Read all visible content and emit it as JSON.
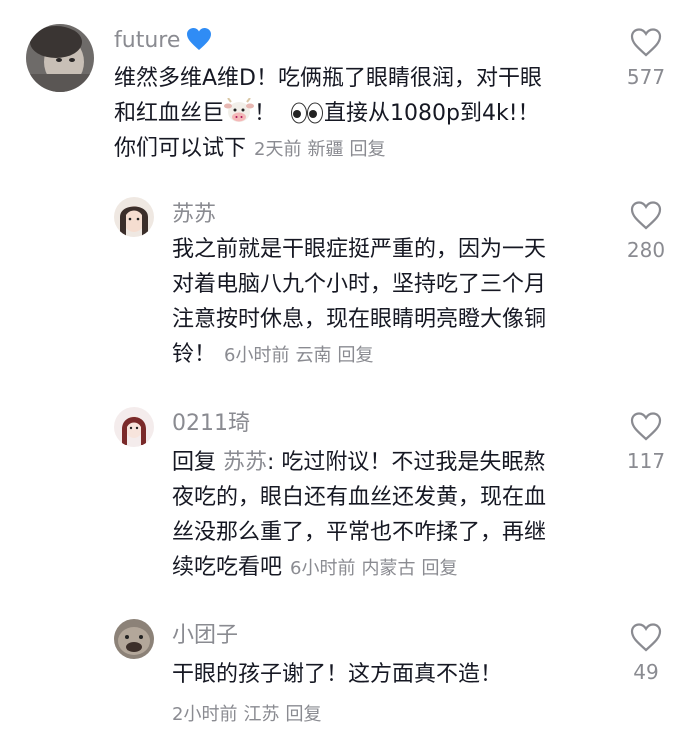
{
  "comments": [
    {
      "username": "future",
      "lines": [
        "维然多维A维D！吃俩瓶了眼睛很润，对干眼",
        "和红血丝巨",
        "！",
        "直接从1080p到4k!！",
        "你们可以试下"
      ],
      "time": "2天前",
      "location": "新疆",
      "reply_label": "回复",
      "likes": "577"
    },
    {
      "username": "苏苏",
      "lines": [
        "我之前就是干眼症挺严重的，因为一天",
        "对着电脑八九个小时，坚持吃了三个月",
        "注意按时休息，现在眼睛明亮瞪大像铜",
        "铃！"
      ],
      "time": "6小时前",
      "location": "云南",
      "reply_label": "回复",
      "likes": "280"
    },
    {
      "username": "0211琦",
      "reply_prefix": "回复",
      "reply_to": "苏苏",
      "lines": [
        ": 吃过附议！不过我是失眠熬",
        "夜吃的，眼白还有血丝还发黄，现在血",
        "丝没那么重了，平常也不咋揉了，再继",
        "续吃吃看吧"
      ],
      "time": "6小时前",
      "location": "内蒙古",
      "reply_label": "回复",
      "likes": "117"
    },
    {
      "username": "小团子",
      "lines": [
        "干眼的孩子谢了！这方面真不造！"
      ],
      "time": "2小时前",
      "location": "江苏",
      "reply_label": "回复",
      "likes": "49"
    }
  ],
  "icons": {
    "like": "heart-outline-icon",
    "verified": "blue-heart-icon",
    "cow": "cow-face-emoji",
    "eyes": "eyes-emoji"
  },
  "colors": {
    "text": "#161823",
    "muted": "#8a8b91",
    "blue_heart": "#2f8cf5"
  }
}
